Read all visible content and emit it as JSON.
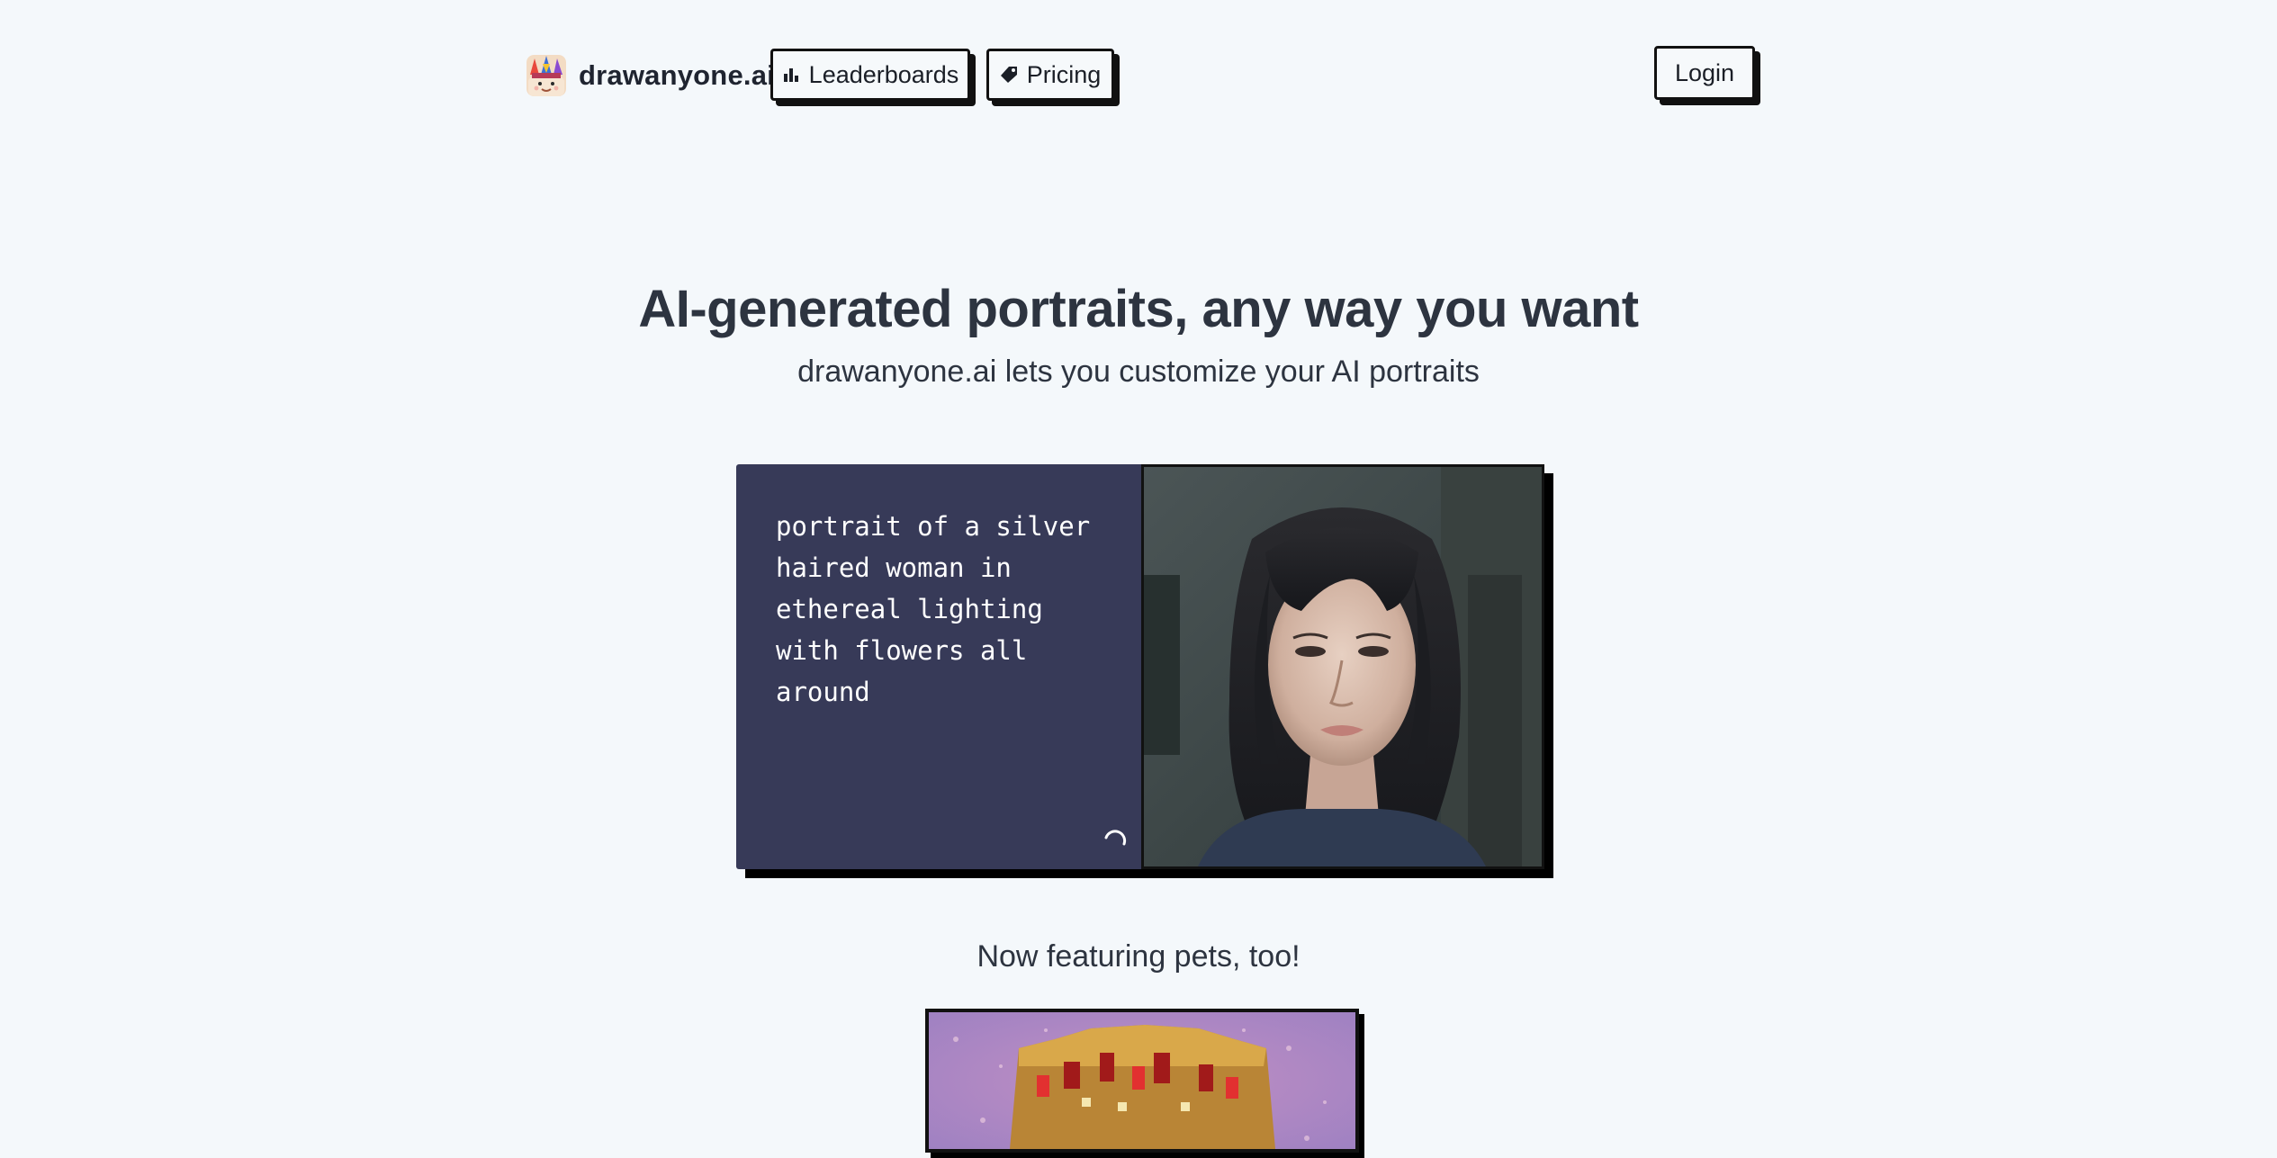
{
  "header": {
    "brand_name": "drawanyone.ai",
    "logo_icon": "unicorn-face-icon",
    "nav": [
      {
        "label": "Leaderboards",
        "icon": "bar-chart-icon"
      },
      {
        "label": "Pricing",
        "icon": "price-tag-icon"
      }
    ],
    "login_label": "Login"
  },
  "hero": {
    "title": "AI-generated portraits, any way you want",
    "subtitle": "drawanyone.ai lets you customize your AI portraits"
  },
  "demo": {
    "prompt": "portrait of a silver\nhaired woman in\nethereal lighting\nwith flowers all\naround",
    "status_icon": "loading-spinner-icon",
    "photo_description_icon": "portrait-photo"
  },
  "pets": {
    "heading": "Now featuring pets, too!"
  },
  "colors": {
    "background": "#f4f8fb",
    "prompt_panel": "#373a58",
    "text_dark": "#2d3440",
    "border": "#111111"
  }
}
